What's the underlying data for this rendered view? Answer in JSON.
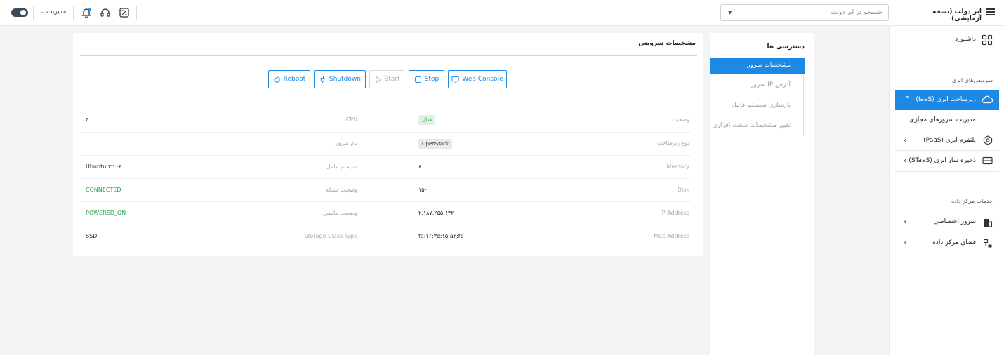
{
  "header": {
    "app_title": "ابر دولت (نسخه آزمایشی)",
    "search_placeholder": "جستجو در ابر دولت",
    "admin_label": "مدیریت"
  },
  "sidebar": {
    "dashboard": "داشبورد",
    "cloud_services_label": "سرویس‌های ابری",
    "iaas": "زیرساخت ابری (IaaS)",
    "vm_management": "مدیریت سرورهای مجازی",
    "paas": "پلتفرم ابری (PaaS)",
    "staas": "ذخیره ساز ابری (STaaS)",
    "datacenter_label": "خدمات مرکز داده",
    "dedicated_server": "سرور اختصاصی",
    "datacenter_space": "فضای مرکز داده"
  },
  "access_panel": {
    "title": "دسترسی ها",
    "items": [
      "مشخصات سرور",
      "آدرس IP سرور",
      "بازسازی سیستم عامل",
      "تغییر مشخصات سخت افزاری"
    ]
  },
  "service": {
    "title": "مشخصات سرویس",
    "buttons": {
      "reboot": "Reboot",
      "shutdown": "Shutdown",
      "start": "Start",
      "stop": "Stop",
      "web_console": "Web Console"
    },
    "right_fields": [
      {
        "label": "وضعیت",
        "value": "فعال"
      },
      {
        "label": "نوع زیرساخت",
        "value": "OpenStack"
      },
      {
        "label": "Memory",
        "value": "۸"
      },
      {
        "label": "Disk",
        "value": "۱۵۰"
      },
      {
        "label": "IP Address",
        "value": "۲.۱۸۷.۲۵۵.۱۴۲"
      },
      {
        "label": "Mac Address",
        "value": "fa:۱۶:۳e:۱۵:a۲:fe"
      }
    ],
    "left_fields": [
      {
        "label": "CPU",
        "value": "۴"
      },
      {
        "label": "نام سرور",
        "value": ""
      },
      {
        "label": "سیستم عامل",
        "value": "Ubuntu ۲۲.۰۴"
      },
      {
        "label": "وضعیت شبکه",
        "value": "CONNECTED"
      },
      {
        "label": "وضعیت ماشین",
        "value": "POWERED_ON"
      },
      {
        "label": "Storage Class Type",
        "value": "SSD"
      }
    ]
  },
  "colors": {
    "accent": "#1e88e5",
    "success": "#2e9d4a",
    "muted_label": "#a7acb2"
  }
}
